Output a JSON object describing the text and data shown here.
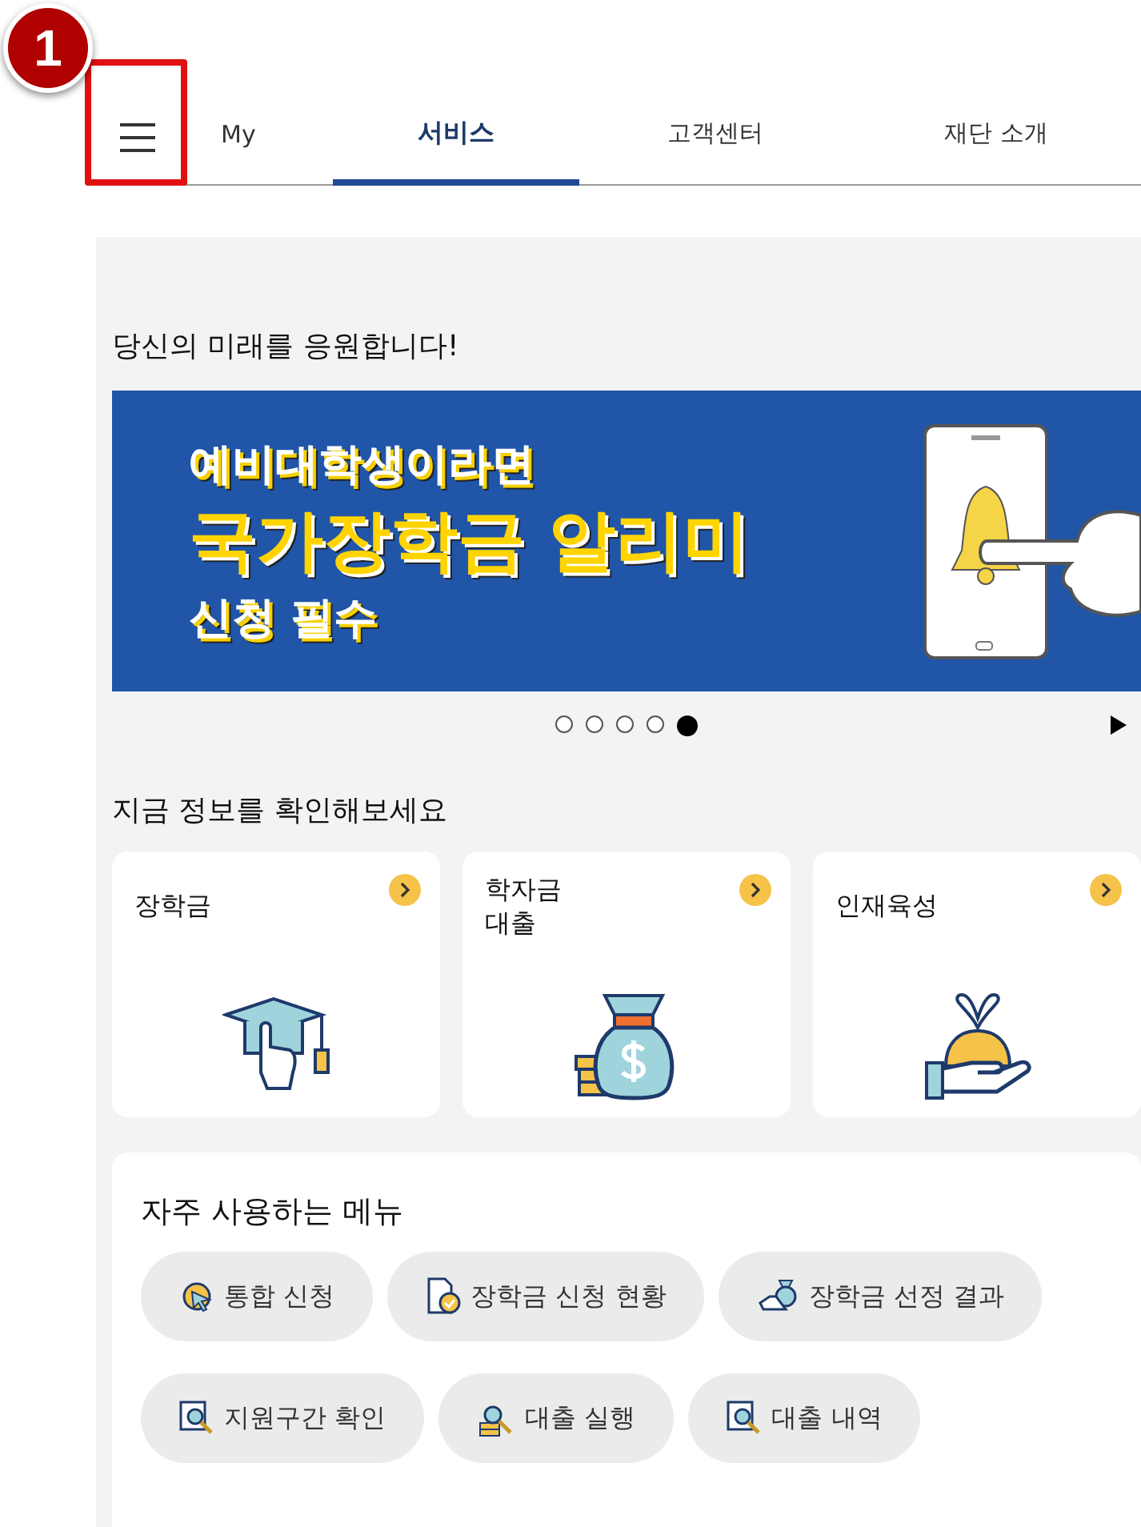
{
  "annotation": {
    "badge": "1"
  },
  "tabs": [
    {
      "label": "My",
      "selected": false
    },
    {
      "label": "서비스",
      "selected": true
    },
    {
      "label": "고객센터",
      "selected": false
    },
    {
      "label": "재단 소개",
      "selected": false
    }
  ],
  "hero": {
    "heading": "당신의 미래를 응원합니다!",
    "banner": {
      "line_1": "예비대학생이라면",
      "line_2": "국가장학금 알리미",
      "line_3": "신청 필수"
    },
    "dots": [
      {
        "selected": false
      },
      {
        "selected": false
      },
      {
        "selected": false
      },
      {
        "selected": false
      },
      {
        "selected": true
      }
    ]
  },
  "info": {
    "heading": "지금 정보를 확인해보세요",
    "cards": [
      {
        "title": "장학금",
        "kind": "graduation"
      },
      {
        "title": "학자금\n대출",
        "kind": "money-bag"
      },
      {
        "title": "인재육성",
        "kind": "growth"
      }
    ]
  },
  "quick_menu": {
    "title": "자주 사용하는 메뉴",
    "items": [
      {
        "label": "통합 신청",
        "kind": "cursor"
      },
      {
        "label": "장학금 신청 현황",
        "kind": "document"
      },
      {
        "label": "장학금 선정 결과",
        "kind": "bag"
      },
      {
        "label": "지원구간 확인",
        "kind": "magnifier"
      },
      {
        "label": "대출 실행",
        "kind": "coins"
      },
      {
        "label": "대출 내역",
        "kind": "magnifier"
      }
    ]
  }
}
